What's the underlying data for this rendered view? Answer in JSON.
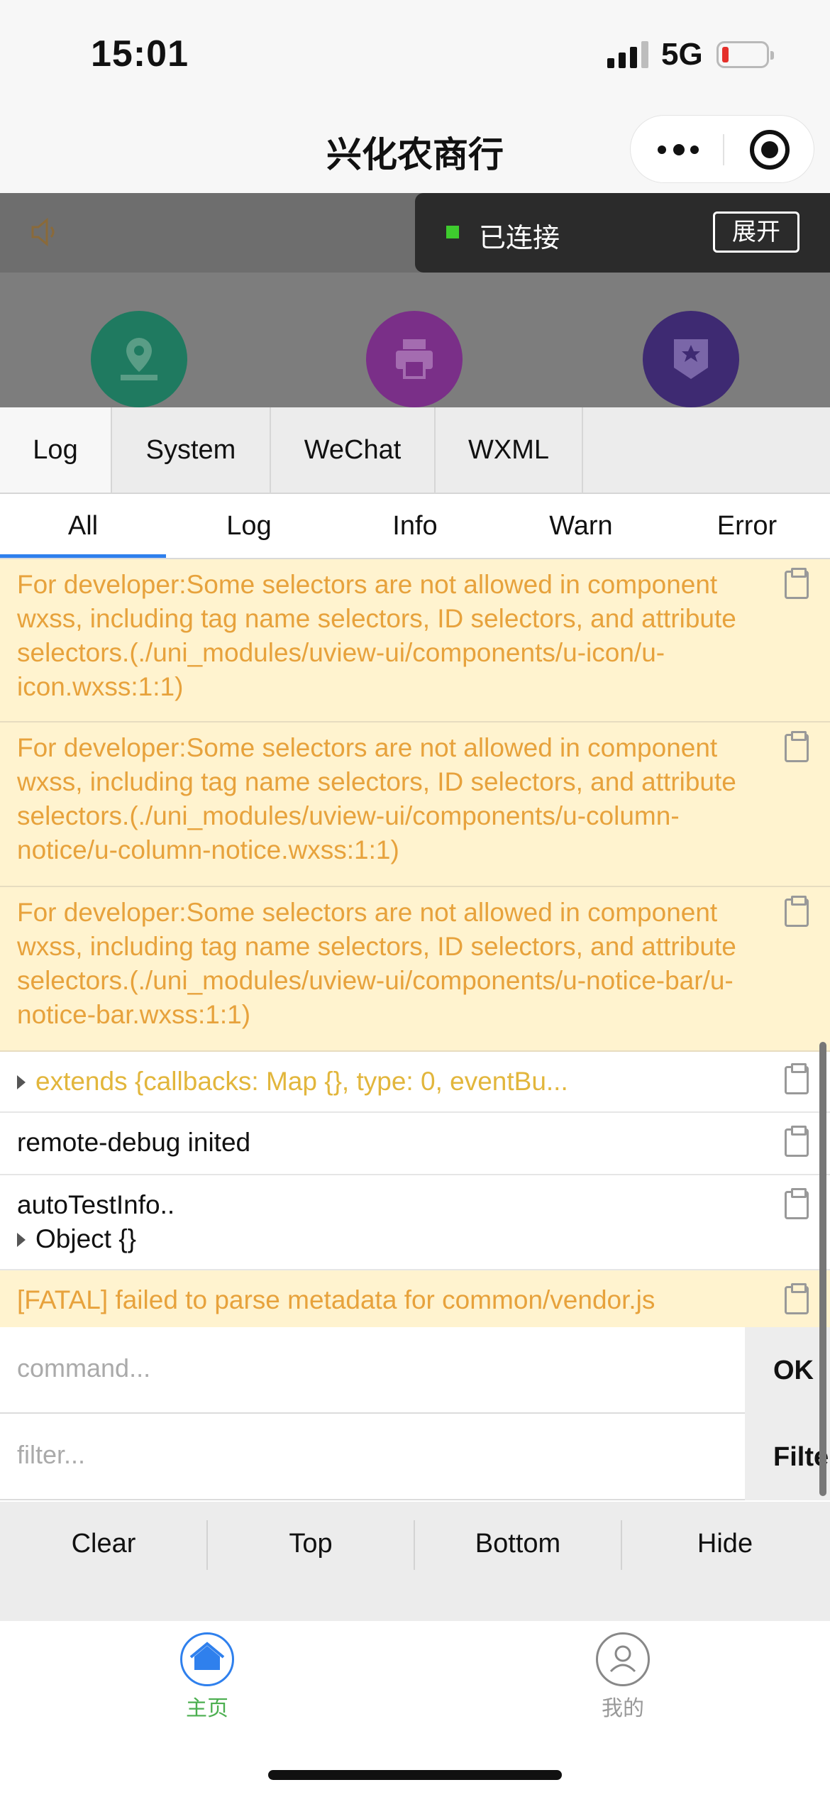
{
  "status_bar": {
    "time": "15:01",
    "network": "5G",
    "battery_color": "#e5302b"
  },
  "nav": {
    "title": "兴化农商行",
    "capsule": {
      "more_icon": "more-dots-icon",
      "close_icon": "target-icon"
    }
  },
  "page_behind": {
    "notice_icon": "speaker-icon",
    "shortcuts": [
      {
        "icon": "location-icon",
        "color": "#1f8a6f"
      },
      {
        "icon": "printer-icon",
        "color": "#9a3ca8"
      },
      {
        "icon": "badge-icon",
        "color": "#4a2c8f"
      }
    ]
  },
  "connection": {
    "status": "已连接",
    "expand_label": "展开",
    "status_color": "#3ecb2e"
  },
  "vconsole": {
    "tabs": [
      "Log",
      "System",
      "WeChat",
      "WXML"
    ],
    "active_tab": "Log",
    "subtabs": [
      "All",
      "Log",
      "Info",
      "Warn",
      "Error"
    ],
    "active_subtab": "All",
    "logs": [
      {
        "type": "warn",
        "text": "For developer:Some selectors are not allowed in component wxss, including tag name selectors, ID selectors, and attribute selectors.(./uni_modules/uview-ui/components/u-icon/u-icon.wxss:1:1)"
      },
      {
        "type": "warn",
        "text": "For developer:Some selectors are not allowed in component wxss, including tag name selectors, ID selectors, and attribute selectors.(./uni_modules/uview-ui/components/u-column-notice/u-column-notice.wxss:1:1)"
      },
      {
        "type": "warn",
        "text": "For developer:Some selectors are not allowed in component wxss, including tag name selectors, ID selectors, and attribute selectors.(./uni_modules/uview-ui/components/u-notice-bar/u-notice-bar.wxss:1:1)"
      },
      {
        "type": "log",
        "text": "extends {callbacks: Map {}, type: 0, eventBu..."
      },
      {
        "type": "log",
        "text": "remote-debug inited"
      },
      {
        "type": "log",
        "text": "autoTestInfo..",
        "sub": "Object {}"
      },
      {
        "type": "warn",
        "text": "[FATAL] failed to parse metadata for common/vendor.js"
      }
    ],
    "command": {
      "placeholder": "command...",
      "button": "OK"
    },
    "filter": {
      "placeholder": "filter...",
      "button": "Filter"
    },
    "toolbar": [
      "Clear",
      "Top",
      "Bottom",
      "Hide"
    ]
  },
  "tabbar": {
    "items": [
      {
        "label": "主页",
        "icon": "home-icon",
        "color": "#4caf50",
        "active": true
      },
      {
        "label": "我的",
        "icon": "user-icon",
        "color": "#999999",
        "active": false
      }
    ]
  }
}
